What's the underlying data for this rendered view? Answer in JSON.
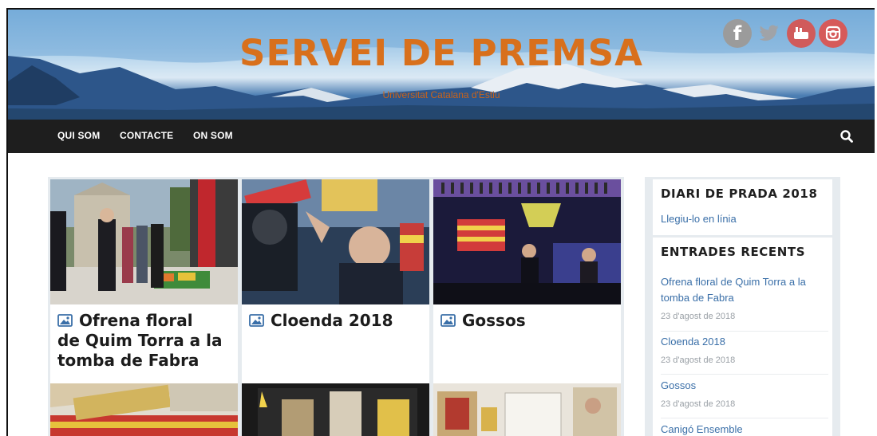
{
  "header": {
    "title": "SERVEI DE PREMSA",
    "tagline": "Universitat Catalana d'Estiu",
    "social": [
      {
        "name": "facebook-icon",
        "glyph": "f"
      },
      {
        "name": "twitter-icon",
        "glyph": "🐦"
      },
      {
        "name": "youtube-icon",
        "glyph": "You Tube"
      },
      {
        "name": "instagram-icon",
        "glyph": ""
      }
    ]
  },
  "nav": {
    "items": [
      "QUI SOM",
      "CONTACTE",
      "ON SOM"
    ],
    "search_icon": "search-icon"
  },
  "posts": [
    {
      "title_line1": "Ofrena floral",
      "title_line2": "de Quim Torra a la",
      "title_line3": "tomba de Fabra"
    },
    {
      "title_line1": "Cloenda 2018"
    },
    {
      "title_line1": "Gossos"
    }
  ],
  "sidebar": {
    "diari": {
      "title": "DIARI DE PRADA 2018",
      "link": "Llegiu-lo en línia"
    },
    "recent": {
      "title": "ENTRADES RECENTS",
      "items": [
        {
          "line1": "Ofrena floral de Quim Torra a la",
          "line2": "tomba de Fabra",
          "date": "23 d'agost de 2018"
        },
        {
          "line1": "Cloenda 2018",
          "date": "23 d'agost de 2018"
        },
        {
          "line1": "Gossos",
          "date": "23 d'agost de 2018"
        },
        {
          "line1": "Canigó Ensemble"
        }
      ]
    }
  },
  "colors": {
    "title_orange": "#d8701c",
    "nav_bg": "#1e1e1e",
    "link_blue": "#3a6fa8"
  }
}
